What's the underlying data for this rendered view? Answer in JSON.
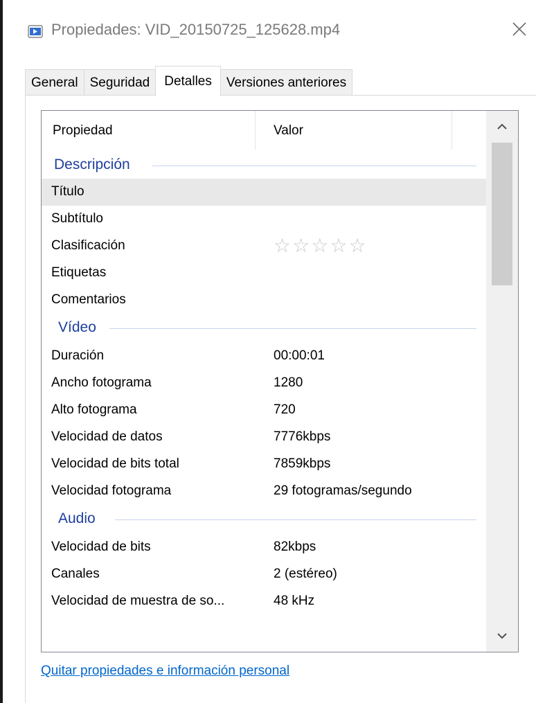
{
  "window": {
    "title": "Propiedades: VID_20150725_125628.mp4",
    "icon": "video-file-icon",
    "close_icon": "close-icon"
  },
  "tabs": [
    {
      "label": "General",
      "active": false
    },
    {
      "label": "Seguridad",
      "active": false
    },
    {
      "label": "Detalles",
      "active": true
    },
    {
      "label": "Versiones anteriores",
      "active": false
    }
  ],
  "list": {
    "columns": {
      "property": "Propiedad",
      "value": "Valor"
    },
    "groups": [
      {
        "label": "Descripción",
        "rows": [
          {
            "name": "Título",
            "value": "",
            "selected": true
          },
          {
            "name": "Subtítulo",
            "value": ""
          },
          {
            "name": "Clasificación",
            "value": "",
            "rating_stars": 5,
            "rating_filled": 0
          },
          {
            "name": "Etiquetas",
            "value": ""
          },
          {
            "name": "Comentarios",
            "value": ""
          }
        ]
      },
      {
        "label": "Vídeo",
        "rows": [
          {
            "name": "Duración",
            "value": "00:00:01"
          },
          {
            "name": "Ancho fotograma",
            "value": "1280"
          },
          {
            "name": "Alto fotograma",
            "value": "720"
          },
          {
            "name": "Velocidad de datos",
            "value": "7776kbps"
          },
          {
            "name": "Velocidad de bits total",
            "value": "7859kbps"
          },
          {
            "name": "Velocidad fotograma",
            "value": "29 fotogramas/segundo"
          }
        ]
      },
      {
        "label": "Audio",
        "rows": [
          {
            "name": "Velocidad de bits",
            "value": "82kbps"
          },
          {
            "name": "Canales",
            "value": "2 (estéreo)"
          },
          {
            "name": "Velocidad de muestra de so...",
            "value": "48 kHz"
          }
        ]
      }
    ]
  },
  "link": {
    "label": "Quitar propiedades e información personal"
  },
  "colors": {
    "group_label": "#1e3f9e",
    "link": "#0066cc",
    "selected_row": "#e8e8e8"
  }
}
